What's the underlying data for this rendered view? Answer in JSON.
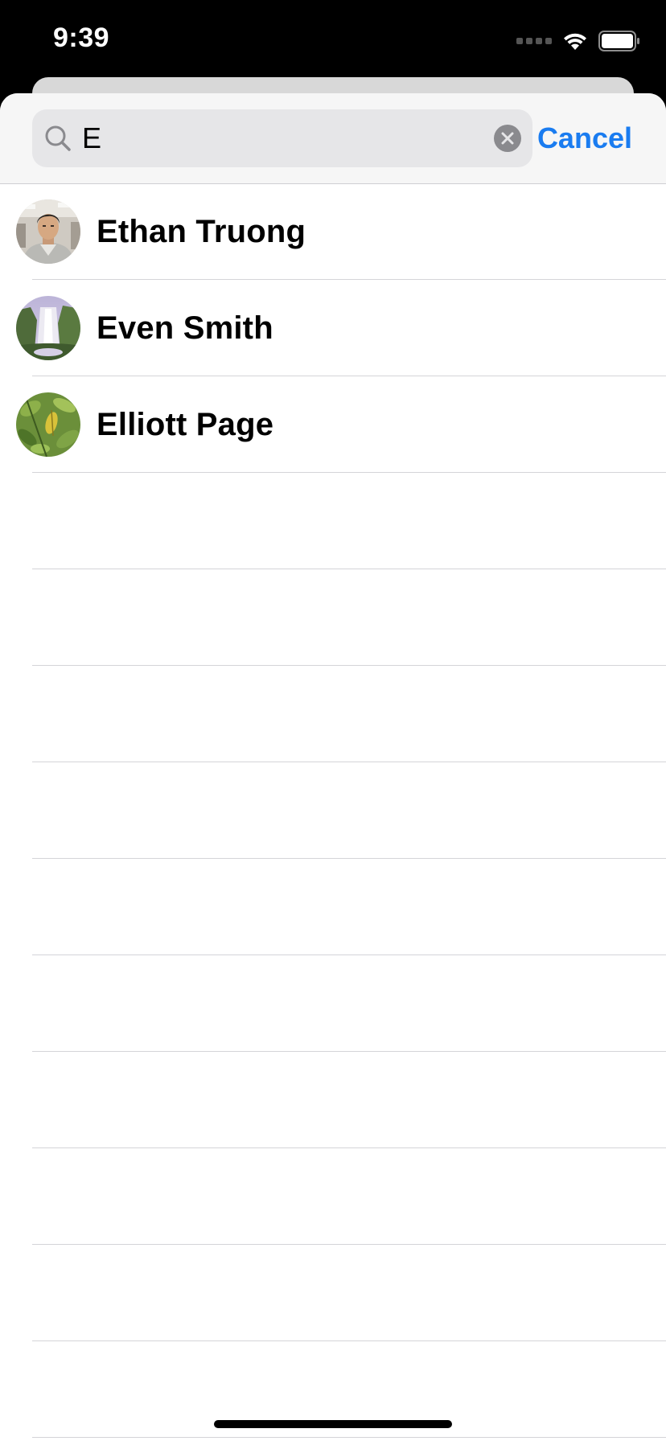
{
  "status_bar": {
    "time": "9:39"
  },
  "search": {
    "value": "E",
    "cancel_label": "Cancel",
    "accent_color": "#1a7cf0"
  },
  "contacts": [
    {
      "name": "Ethan Truong",
      "avatar": "person-photo"
    },
    {
      "name": "Even Smith",
      "avatar": "waterfall-photo"
    },
    {
      "name": "Elliott Page",
      "avatar": "leaves-photo"
    }
  ],
  "icons": {
    "search": "magnifying-glass",
    "clear": "x-circle",
    "wifi": "wifi",
    "battery": "battery-full",
    "cellular": "cellular-signal"
  }
}
